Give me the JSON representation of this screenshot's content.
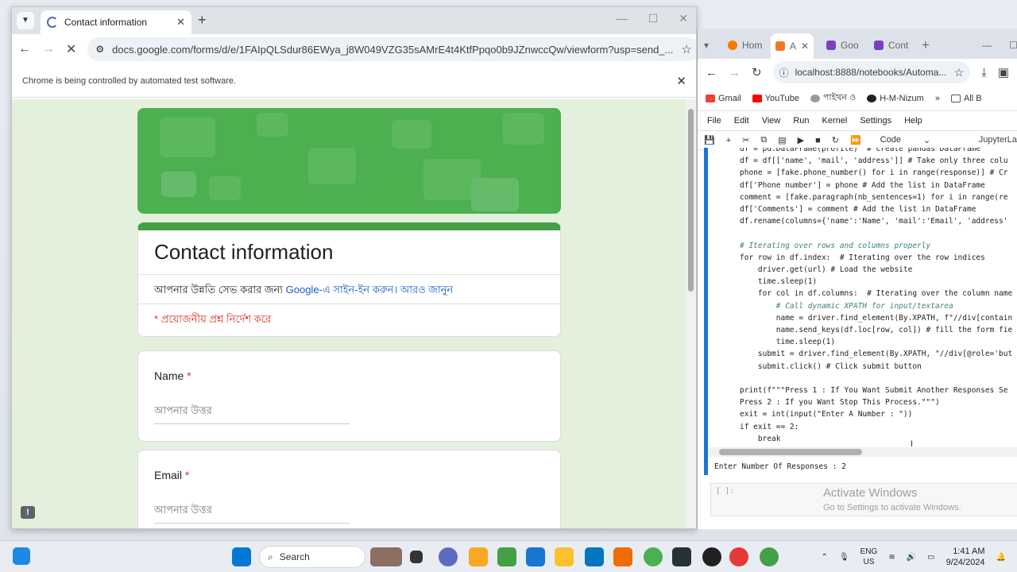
{
  "left_window": {
    "tab_title": "Contact information",
    "url": "docs.google.com/forms/d/e/1FAIpQLSdur86EWya_j8W049VZG35sAMrE4t4KtfPpqo0b9JZnwccQw/viewform?usp=send_...",
    "infobar_text": "Chrome is being controlled by automated test software.",
    "form": {
      "title": "Contact information",
      "signin_prefix": "আপনার উন্নতি সেভ করার জন্য ",
      "signin_link": "Google-এ সাইন-ইন করুন।",
      "learn_more": " আরও জানুন",
      "required_note": "* প্রয়োজনীয় প্রশ্ন নির্দেশ করে",
      "questions": [
        {
          "label": "Name",
          "required": "*",
          "placeholder": "আপনার উত্তর"
        },
        {
          "label": "Email",
          "required": "*",
          "placeholder": "আপনার উত্তর"
        }
      ]
    }
  },
  "right_window": {
    "tabs": [
      "Hom",
      "A",
      "Goo",
      "Cont"
    ],
    "url": "localhost:8888/notebooks/Automa...",
    "bookmarks": [
      "Gmail",
      "YouTube",
      "পাইথন ও",
      "H-M-Nizum",
      "All B"
    ],
    "menu": [
      "File",
      "Edit",
      "View",
      "Run",
      "Kernel",
      "Settings",
      "Help"
    ],
    "cell_type": "Code",
    "kernel_label": "JupyterLa",
    "code_lines": [
      "df = pd.DataFrame(profile)  # Create pandas DataFrame",
      "df = df[['name', 'mail', 'address']] # Take only three colu",
      "phone = [fake.phone_number() for i in range(response)] # Cr",
      "df['Phone number'] = phone # Add the list in DataFrame",
      "comment = [fake.paragraph(nb_sentences=1) for i in range(re",
      "df['Comments'] = comment # Add the list in DataFrame",
      "df.rename(columns={'name':'Name', 'mail':'Email', 'address'",
      "",
      "# Iterating over rows and columns properly",
      "for row in df.index:  # Iterating over the row indices",
      "    driver.get(url) # Load the website",
      "    time.sleep(1)",
      "    for col in df.columns:  # Iterating over the column name",
      "        # Call dynamic XPATH for input/textarea",
      "        name = driver.find_element(By.XPATH, f\"//div[contain",
      "        name.send_keys(df.loc[row, col]) # fill the form fie",
      "        time.sleep(1)",
      "    submit = driver.find_element(By.XPATH, \"//div[@role='but",
      "    submit.click() # Click submit button",
      "",
      "print(f\"\"\"Press 1 : If You Want Submit Another Responses Se",
      "Press 2 : If you Want Stop This Process.\"\"\")",
      "exit = int(input(\"Enter A Number : \"))",
      "if exit == 2:",
      "    break"
    ],
    "output_text": "Enter Number Of Responses :  2",
    "empty_prompt": "[ ]:",
    "activate_title": "Activate Windows",
    "activate_sub": "Go to Settings to activate Windows."
  },
  "taskbar": {
    "search_label": "Search",
    "lang_top": "ENG",
    "lang_bottom": "US",
    "time": "1:41 AM",
    "date": "9/24/2024"
  }
}
